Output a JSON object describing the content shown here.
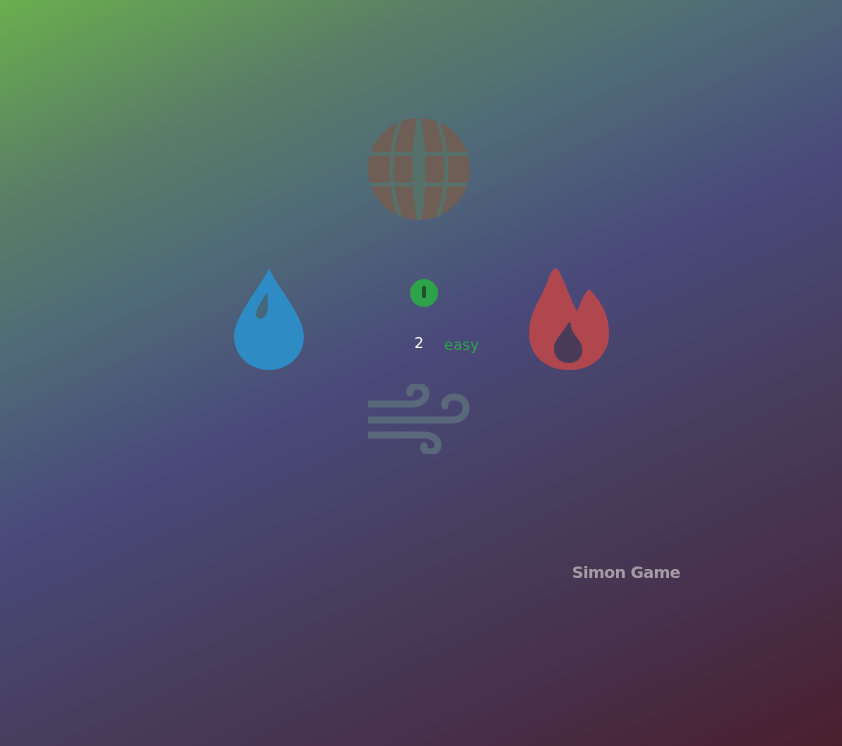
{
  "game": {
    "title": "Simon Game",
    "count": "2",
    "difficulty": "easy",
    "power_on": true
  },
  "pads": [
    {
      "name": "earth",
      "icon": "globe-icon",
      "color": "#6e5e56"
    },
    {
      "name": "water",
      "icon": "water-drop-icon",
      "color": "#2f8bc4"
    },
    {
      "name": "fire",
      "icon": "fire-icon",
      "color": "#b0474f"
    },
    {
      "name": "air",
      "icon": "wind-icon",
      "color": "#59687a"
    }
  ],
  "colors": {
    "power": "#2ea24a",
    "difficulty": "#2ea24a",
    "count": "#ffffff",
    "title": "#a49ba4"
  }
}
